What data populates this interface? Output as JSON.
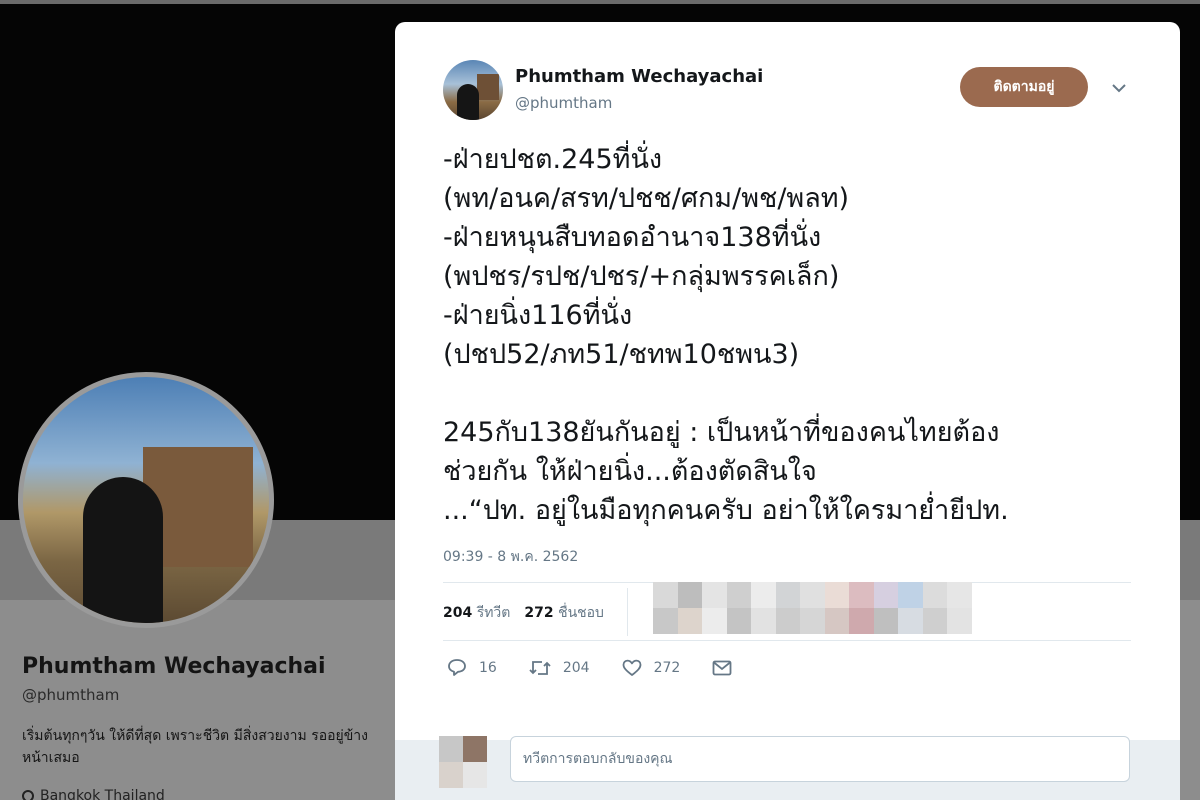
{
  "background_profile": {
    "name": "Phumtham Wechayachai",
    "handle": "@phumtham",
    "bio": "เริ่มต้นทุกๆวัน ให้ดีที่สุด เพราะชีวิต มีสิ่งสวยงาม รออยู่ข้างหน้าเสมอ",
    "location": "Bangkok Thailand"
  },
  "tweet": {
    "author_name": "Phumtham Wechayachai",
    "author_handle": "@phumtham",
    "follow_label": "ติดตามอยู่",
    "text": "-ฝ่ายปชต.245ที่นั่ง\n(พท/อนค/สรท/ปชช/ศกม/พช/พลท)\n-ฝ่ายหนุนสืบทอดอำนาจ138ที่นั่ง\n(พปชร/รปช/ปชร/+กลุ่มพรรคเล็ก)\n-ฝ่ายนิ่ง116ที่นั่ง\n(ปชป52/ภท51/ชทพ10ชพน3)\n\n245กับ138ยันกันอยู่ : เป็นหน้าที่ของคนไทยต้อง\nช่วยกัน ให้ฝ่ายนิ่ง...ต้องตัดสินใจ\n...“ปท. อยู่ในมือทุกคนครับ อย่าให้ใครมาย่ำยีปท.",
    "timestamp": "09:39 - 8 พ.ค. 2562"
  },
  "stats": {
    "retweets_count": "204",
    "retweets_label": "รีทวีต",
    "likes_count": "272",
    "likes_label": "ชื่นชอบ"
  },
  "actions": {
    "reply_count": "16",
    "retweet_count": "204",
    "like_count": "272"
  },
  "reply": {
    "placeholder": "ทวีตการตอบกลับของคุณ"
  },
  "colors": {
    "follow_button": "#9b6a4f",
    "text_primary": "#14171a",
    "text_secondary": "#657786",
    "overlay_background": "#121212"
  },
  "icons": [
    "chevron-down-icon",
    "reply-icon",
    "retweet-icon",
    "like-icon",
    "message-icon",
    "location-pin-icon"
  ]
}
